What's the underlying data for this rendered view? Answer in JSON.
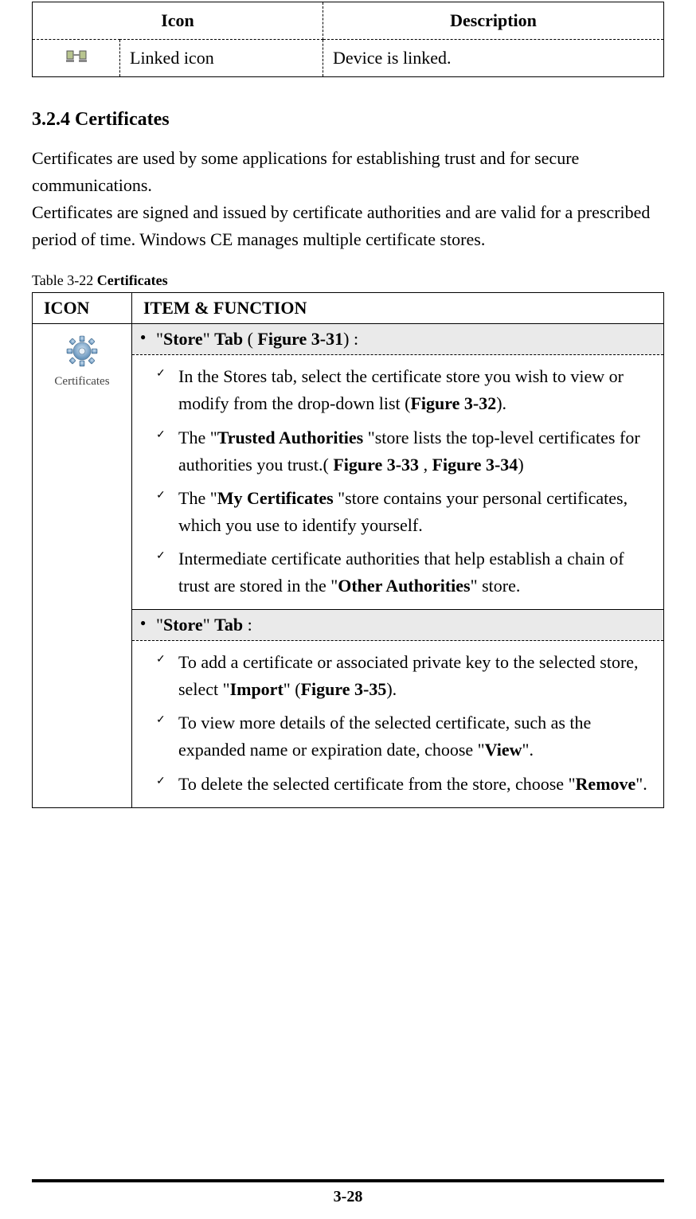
{
  "table1": {
    "headers": {
      "icon": "Icon",
      "desc": "Description"
    },
    "row": {
      "name": "Linked icon",
      "desc": "Device is linked."
    }
  },
  "heading": "3.2.4 Certificates",
  "para1": "Certificates are used by some applications for establishing trust and for secure communications.",
  "para2": "Certificates are signed and issued by certificate authorities and are valid for a prescribed period of time. Windows CE manages multiple certificate stores.",
  "caption": {
    "prefix": "Table 3-22 ",
    "title": "Certificates"
  },
  "table2": {
    "headers": {
      "icon": "ICON",
      "func": "ITEM & FUNCTION"
    },
    "icon_label": "Certificates",
    "sections": [
      {
        "tab": {
          "q1": "\"",
          "store": "Store",
          "q2": "\" ",
          "tab": "Tab",
          "paren_open": " ( ",
          "fig": "Figure 3-31",
          "paren_close": ") :"
        },
        "items": [
          {
            "pre": "In the Stores tab, select the certificate store you wish to view or modify from the drop-down list (",
            "b1": "Figure 3-32",
            "post": ")."
          },
          {
            "pre": "The \"",
            "b1": "Trusted Authorities ",
            "mid": "\"store lists the top-level certificates for authorities you trust.( ",
            "b2": "Figure 3-33",
            "sep": " , ",
            "b3": "Figure 3-34",
            "post": ")"
          },
          {
            "pre": "The \"",
            "b1": "My Certificates ",
            "mid": "\"store contains your personal certificates, which you use to identify yourself.",
            "post": ""
          },
          {
            "pre": "Intermediate certificate authorities that help establish a chain of trust are stored in the \"",
            "b1": "Other Authorities",
            "post": "\" store."
          }
        ]
      },
      {
        "tab": {
          "q1": "\"",
          "store": "Store",
          "q2": "\" ",
          "tab": "Tab",
          "post": " :"
        },
        "items": [
          {
            "pre": "To add a certificate or associated private key to the selected store, select \"",
            "b1": "Import",
            "mid": "\" (",
            "b2": "Figure 3-35",
            "post": ")."
          },
          {
            "pre": "To view more details of the selected certificate, such as the expanded name or expiration date, choose \"",
            "b1": "View",
            "post": "\"."
          },
          {
            "pre": "To delete the selected certificate from the store, choose \"",
            "b1": "Remove",
            "post": "\"."
          }
        ]
      }
    ]
  },
  "page_number": "3-28"
}
